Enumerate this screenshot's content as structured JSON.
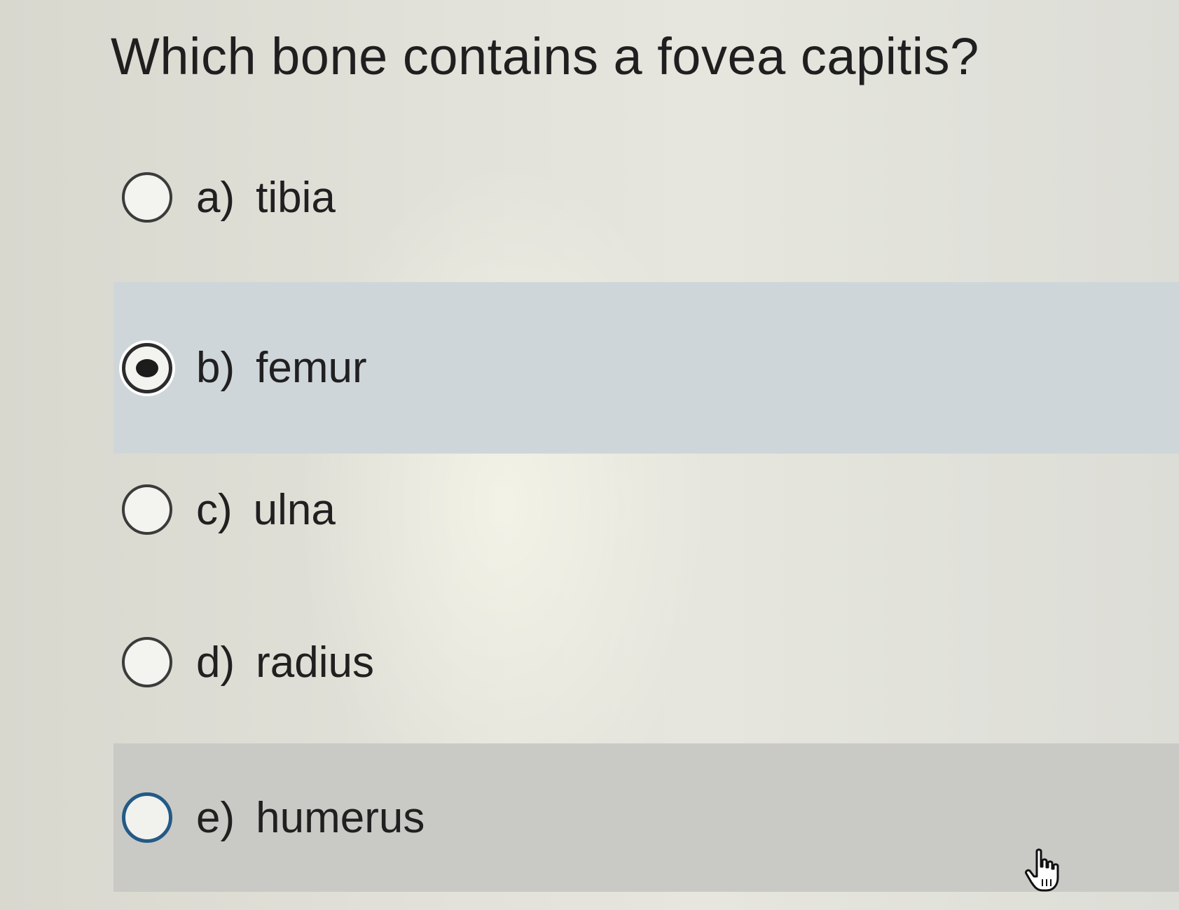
{
  "question": {
    "text": "Which bone contains a fovea capitis?"
  },
  "options": [
    {
      "letter": "a)",
      "text": "tibia",
      "selected": false
    },
    {
      "letter": "b)",
      "text": "femur",
      "selected": true
    },
    {
      "letter": "c)",
      "text": "ulna",
      "selected": false
    },
    {
      "letter": "d)",
      "text": "radius",
      "selected": false
    },
    {
      "letter": "e)",
      "text": "humerus",
      "selected": false
    }
  ],
  "colors": {
    "page_background": "#dcdcd3",
    "selected_row": "#cfd6da",
    "hover_row": "#c9cac5",
    "focus_ring": "#235a86",
    "text": "#202020"
  },
  "icons": {
    "pointer": "hand-pointer-icon"
  }
}
